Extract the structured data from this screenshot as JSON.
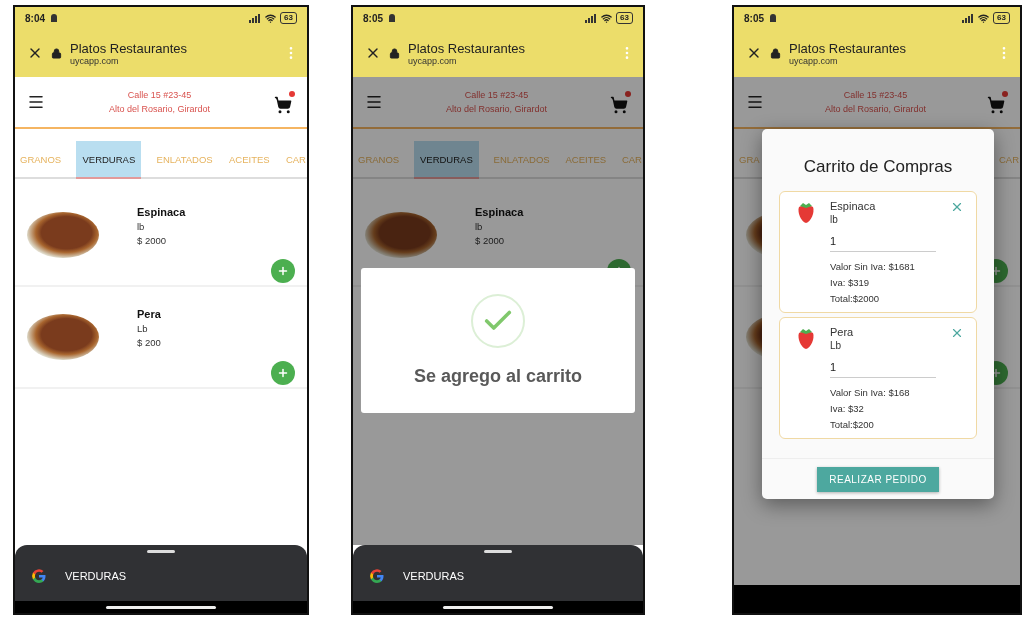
{
  "phones": [
    {
      "status_bar": {
        "time": "8:04",
        "battery": "63"
      },
      "browser": {
        "title": "Platos Restaurantes",
        "url": "uycapp.com"
      },
      "header": {
        "address_lines": [
          "Calle 15 #23-45",
          "Alto del Rosario, Girardot"
        ]
      },
      "tabs": [
        {
          "label": "GRANOS",
          "selected": false
        },
        {
          "label": "VERDURAS",
          "selected": true
        },
        {
          "label": "ENLATADOS",
          "selected": false
        },
        {
          "label": "ACEITES",
          "selected": false
        },
        {
          "label": "CAR",
          "selected": false
        }
      ],
      "products": [
        {
          "name": "Espinaca",
          "unit": "lb",
          "price": "$ 2000",
          "add_button": true
        },
        {
          "name": "Pera",
          "unit": "Lb",
          "price": "$ 200",
          "add_button": true
        }
      ],
      "overlay": {
        "kind": "none"
      },
      "search_sheet": {
        "query": "VERDURAS"
      }
    },
    {
      "status_bar": {
        "time": "8:05",
        "battery": "63"
      },
      "browser": {
        "title": "Platos Restaurantes",
        "url": "uycapp.com"
      },
      "header": {
        "address_lines": [
          "Calle 15 #23-45",
          "Alto del Rosario, Girardot"
        ]
      },
      "tabs": [
        {
          "label": "GRANOS",
          "selected": false
        },
        {
          "label": "VERDURAS",
          "selected": true
        },
        {
          "label": "ENLATADOS",
          "selected": false
        },
        {
          "label": "ACEITES",
          "selected": false
        },
        {
          "label": "CAR",
          "selected": false
        }
      ],
      "products": [
        {
          "name": "Espinaca",
          "unit": "lb",
          "price": "$ 2000",
          "add_button": true
        }
      ],
      "overlay": {
        "kind": "toast",
        "message": "Se agrego al carrito"
      },
      "search_sheet": {
        "query": "VERDURAS"
      }
    },
    {
      "status_bar": {
        "time": "8:05",
        "battery": "63"
      },
      "browser": {
        "title": "Platos Restaurantes",
        "url": "uycapp.com"
      },
      "header": {
        "address_lines": [
          "Calle 15 #23-45",
          "Alto del Rosario, Girardot"
        ]
      },
      "tabs": [
        {
          "label": "GRA",
          "selected": false
        },
        {
          "label": "CAR",
          "selected": false
        }
      ],
      "products": [
        {
          "add_button": true
        },
        {
          "add_button": true
        }
      ],
      "overlay": {
        "kind": "cart",
        "title": "Carrito de Compras",
        "button": "REALIZAR PEDIDO",
        "items": [
          {
            "name": "Espinaca",
            "unit": "lb",
            "quantity": "1",
            "lines": [
              "Valor Sin Iva: $1681",
              "Iva: $319",
              "Total:$2000"
            ]
          },
          {
            "name": "Pera",
            "unit": "Lb",
            "quantity": "1",
            "lines": [
              "Valor Sin Iva: $168",
              "Iva: $32",
              "Total:$200"
            ]
          }
        ]
      }
    }
  ]
}
